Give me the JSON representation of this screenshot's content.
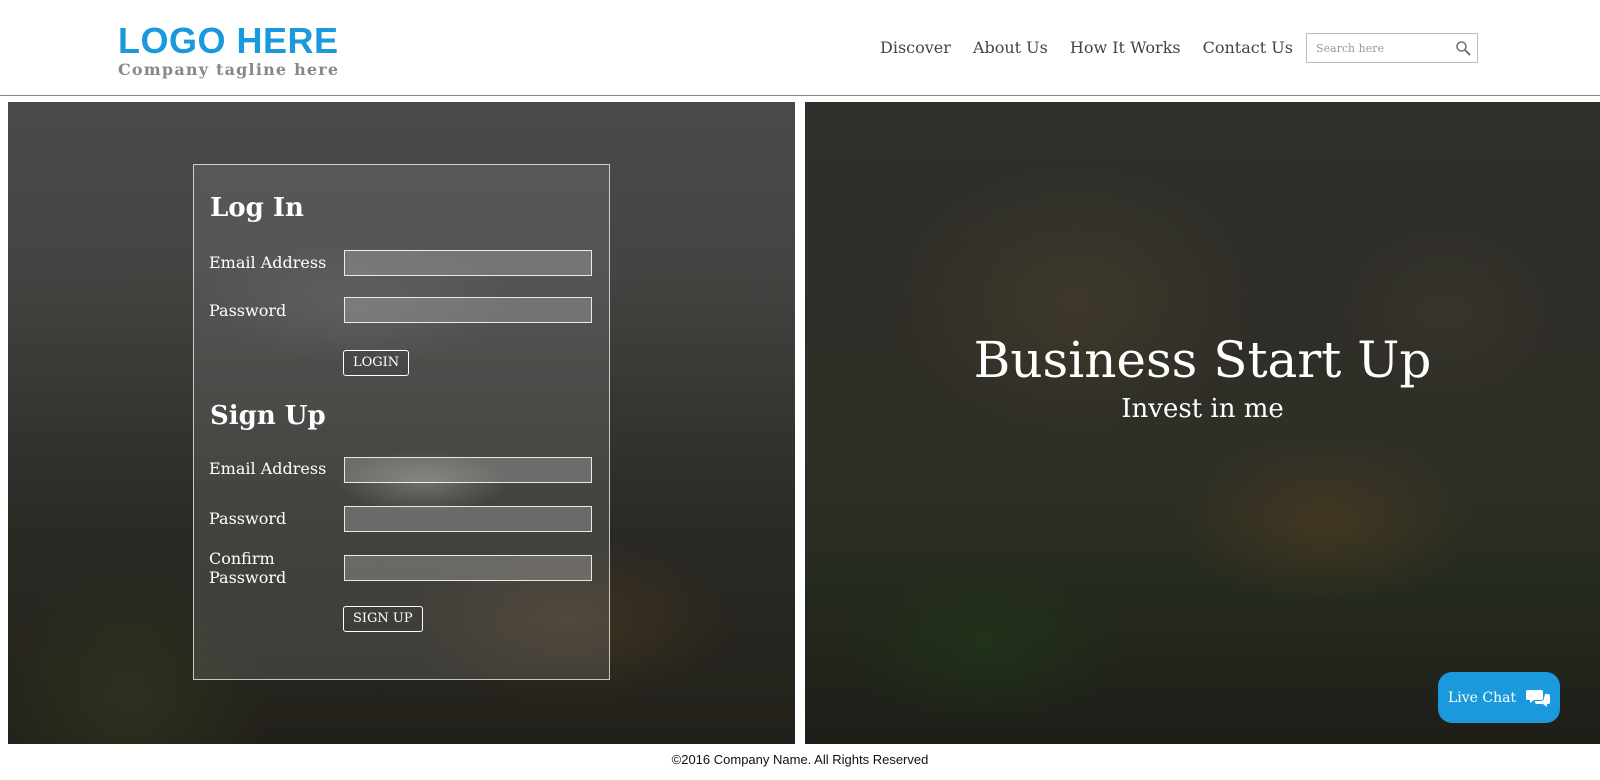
{
  "header": {
    "logo_text": "LOGO HERE",
    "tagline": "Company tagline here",
    "nav": [
      "Discover",
      "About Us",
      "How It Works",
      "Contact Us"
    ],
    "search_placeholder": "Search here"
  },
  "login": {
    "title": "Log In",
    "email_label": "Email Address",
    "password_label": "Password",
    "button": "LOGIN"
  },
  "signup": {
    "title": "Sign Up",
    "email_label": "Email Address",
    "password_label": "Password",
    "confirm_label": "Confirm Password",
    "button": "SIGN UP"
  },
  "hero": {
    "title": "Business Start Up",
    "subtitle": "Invest in me"
  },
  "live_chat": {
    "label": "Live Chat"
  },
  "footer": {
    "copyright": "©2016 Company Name. All Rights Reserved"
  },
  "colors": {
    "brand": "#1a99dd",
    "tagline": "#888888"
  },
  "icons": [
    "search-icon",
    "chat-bubbles-icon"
  ]
}
